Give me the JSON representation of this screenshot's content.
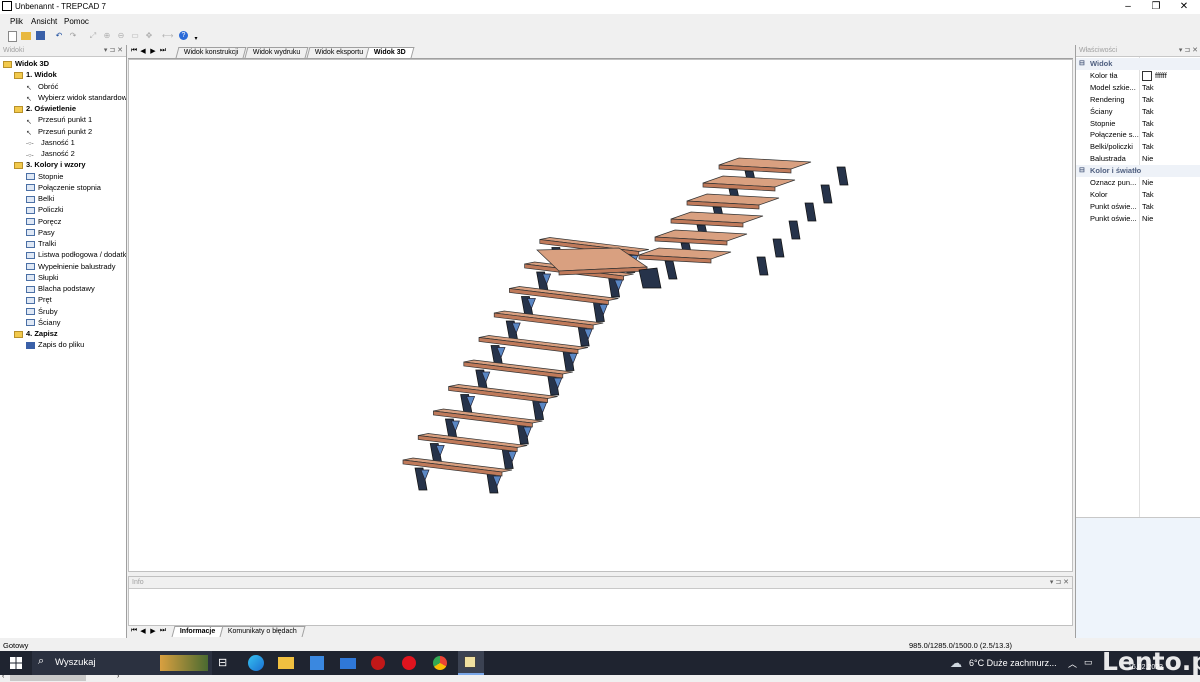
{
  "window": {
    "title": "Unbenannt - TREPCAD 7",
    "minimize": "–",
    "maximize": "❐",
    "close": "✕"
  },
  "menu": [
    "Plik",
    "Ansicht",
    "Pomoc"
  ],
  "left_panel": {
    "title": "Widoki"
  },
  "tree": [
    {
      "label": "Widok 3D",
      "level": 0,
      "icon": "folder",
      "bold": true
    },
    {
      "label": "1. Widok",
      "level": 1,
      "icon": "folder",
      "bold": true
    },
    {
      "label": "Obróć",
      "level": 2,
      "icon": "arrow",
      "bold": false
    },
    {
      "label": "Wybierz widok standardowy",
      "level": 2,
      "icon": "arrow",
      "bold": false
    },
    {
      "label": "2. Oświetlenie",
      "level": 1,
      "icon": "folder",
      "bold": true
    },
    {
      "label": "Przesuń punkt 1",
      "level": 2,
      "icon": "arrow",
      "bold": false
    },
    {
      "label": "Przesuń punkt 2",
      "level": 2,
      "icon": "arrow",
      "bold": false
    },
    {
      "label": "Jasność 1",
      "level": 2,
      "icon": "slider",
      "bold": false
    },
    {
      "label": "Jasność 2",
      "level": 2,
      "icon": "slider",
      "bold": false
    },
    {
      "label": "3. Kolory i wzory",
      "level": 1,
      "icon": "folder",
      "bold": true
    },
    {
      "label": "Stopnie",
      "level": 2,
      "icon": "leaf",
      "bold": false
    },
    {
      "label": "Połączenie stopnia",
      "level": 2,
      "icon": "leaf",
      "bold": false
    },
    {
      "label": "Belki",
      "level": 2,
      "icon": "leaf",
      "bold": false
    },
    {
      "label": "Policzki",
      "level": 2,
      "icon": "leaf",
      "bold": false
    },
    {
      "label": "Poręcz",
      "level": 2,
      "icon": "leaf",
      "bold": false
    },
    {
      "label": "Pasy",
      "level": 2,
      "icon": "leaf",
      "bold": false
    },
    {
      "label": "Tralki",
      "level": 2,
      "icon": "leaf",
      "bold": false
    },
    {
      "label": "Listwa podłogowa / dodatkowa",
      "level": 2,
      "icon": "leaf",
      "bold": false
    },
    {
      "label": "Wypełnienie balustrady",
      "level": 2,
      "icon": "leaf",
      "bold": false
    },
    {
      "label": "Słupki",
      "level": 2,
      "icon": "leaf",
      "bold": false
    },
    {
      "label": "Blacha podstawy",
      "level": 2,
      "icon": "leaf",
      "bold": false
    },
    {
      "label": "Pręt",
      "level": 2,
      "icon": "leaf",
      "bold": false
    },
    {
      "label": "Śruby",
      "level": 2,
      "icon": "leaf",
      "bold": false
    },
    {
      "label": "Ściany",
      "level": 2,
      "icon": "leaf",
      "bold": false
    },
    {
      "label": "4. Zapisz",
      "level": 1,
      "icon": "folder",
      "bold": true
    },
    {
      "label": "Zapis do pliku",
      "level": 2,
      "icon": "save",
      "bold": false
    }
  ],
  "tabs": [
    "Widok konstrukcji",
    "Widok wydruku",
    "Widok eksportu",
    "Widok 3D"
  ],
  "active_tab": "Widok 3D",
  "info_panel": {
    "title": "Info"
  },
  "bottom_tabs": [
    "Informacje",
    "Komunikaty o błędach"
  ],
  "properties": {
    "title": "Właściwości",
    "groups": [
      {
        "name": "Widok",
        "rows": [
          {
            "name": "Kolor tła",
            "value": "ffffff"
          },
          {
            "name": "Model szkie...",
            "value": "Tak"
          },
          {
            "name": "Rendering",
            "value": "Tak"
          },
          {
            "name": "Ściany",
            "value": "Tak"
          },
          {
            "name": "Stopnie",
            "value": "Tak"
          },
          {
            "name": "Połączenie s...",
            "value": "Tak"
          },
          {
            "name": "Belki/policzki",
            "value": "Tak"
          },
          {
            "name": "Balustrada",
            "value": "Nie"
          }
        ]
      },
      {
        "name": "Kolor i światło",
        "rows": [
          {
            "name": "Oznacz pun...",
            "value": "Nie"
          },
          {
            "name": "Kolor",
            "value": "Tak"
          },
          {
            "name": "Punkt oświe...",
            "value": "Tak"
          },
          {
            "name": "Punkt oświe...",
            "value": "Nie"
          }
        ]
      }
    ]
  },
  "status": {
    "left": "Gotowy",
    "coords": "985.0/1285.0/1500.0 (2.5/13.3)"
  },
  "taskbar": {
    "search": "Wyszukaj",
    "weather": "6°C  Duże zachmurz...",
    "date": "16.02.2023"
  },
  "watermark": "Lento.pl",
  "colors": {
    "tread": "#d9a080",
    "stringer": "#5a87c4",
    "accent": "#2a5aa8"
  }
}
